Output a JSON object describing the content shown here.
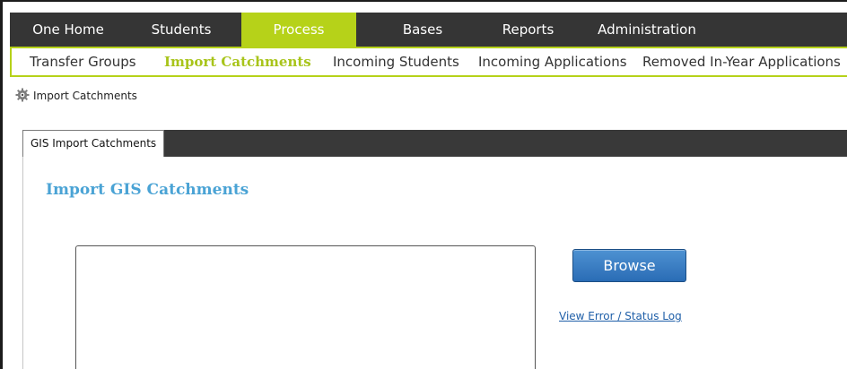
{
  "top_nav": {
    "items": [
      {
        "label": "One Home"
      },
      {
        "label": "Students"
      },
      {
        "label": "Process"
      },
      {
        "label": "Bases"
      },
      {
        "label": "Reports"
      },
      {
        "label": "Administration"
      }
    ],
    "active": "Process",
    "bar_color": "#353535",
    "active_color": "#b6d219"
  },
  "sub_nav": {
    "items": [
      {
        "label": "Transfer Groups"
      },
      {
        "label": "Import Catchments"
      },
      {
        "label": "Incoming Students"
      },
      {
        "label": "Incoming Applications"
      },
      {
        "label": "Removed In-Year Applications"
      }
    ],
    "active": "Import Catchments"
  },
  "breadcrumb": {
    "icon": "gear-icon",
    "label": "Import Catchments"
  },
  "tabs": [
    {
      "label": "GIS Import Catchments"
    }
  ],
  "main": {
    "title": "Import GIS Catchments",
    "title_color": "#4aa3d5",
    "browse_label": "Browse",
    "browse_color": "#2f74bd",
    "error_log_link": "View Error / Status Log"
  }
}
